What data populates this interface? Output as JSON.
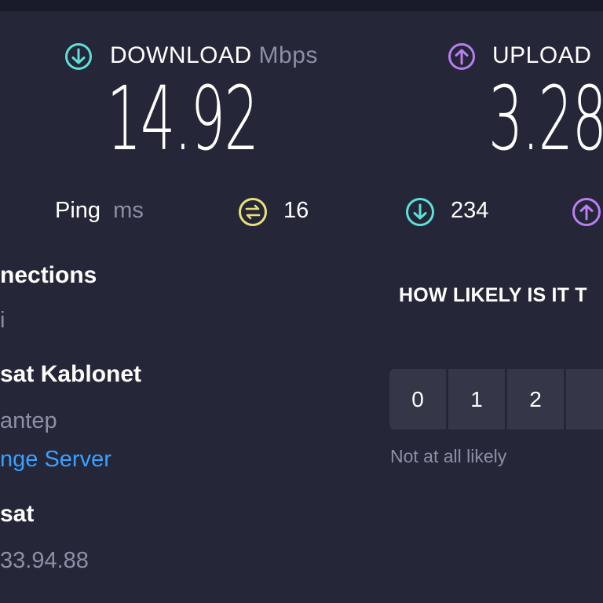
{
  "download": {
    "label": "DOWNLOAD",
    "unit": "Mbps",
    "value": "14.92"
  },
  "upload": {
    "label": "UPLOAD",
    "value": "3.28"
  },
  "ping": {
    "label": "Ping",
    "unit": "ms",
    "idle": "16",
    "down": "234"
  },
  "info": {
    "connections_label": "nections",
    "connections_value": "i",
    "isp_name": "sat Kablonet",
    "location": "antep",
    "change_server": "nge Server",
    "host": "sat",
    "ip": "33.94.88"
  },
  "survey": {
    "question": "HOW LIKELY IS IT T",
    "scale": [
      "0",
      "1",
      "2"
    ],
    "hint_low": "Not at all likely"
  },
  "colors": {
    "background": "#252638",
    "download_accent": "#5de0d8",
    "upload_accent": "#b97ef0",
    "ping_accent": "#e8e07a",
    "link": "#3aa0ff"
  }
}
